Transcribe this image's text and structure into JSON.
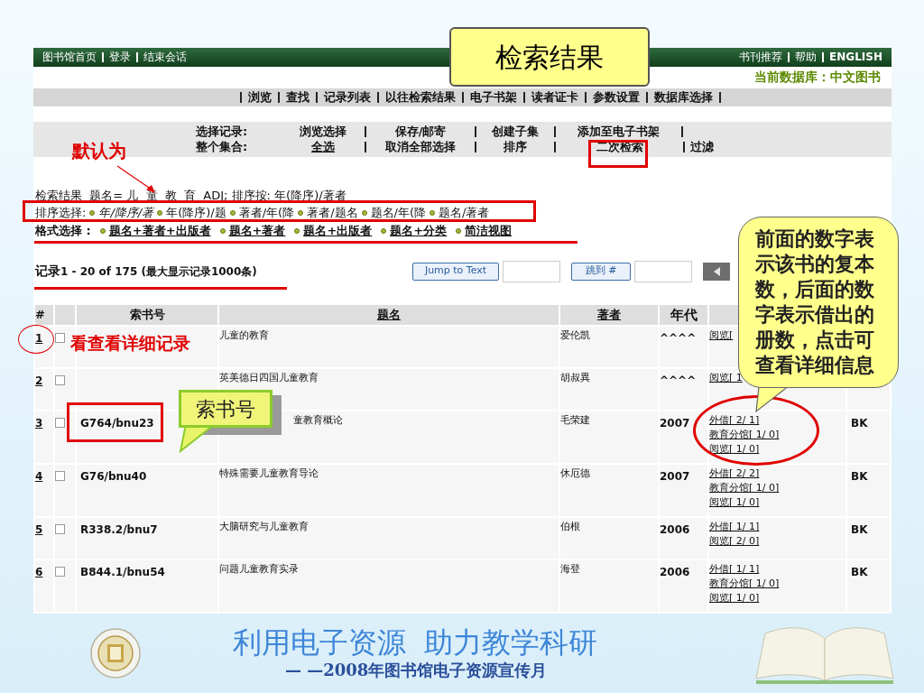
{
  "title_callout": "检索结果",
  "top_bar": {
    "left_links": [
      "图书馆首页",
      "登录",
      "结束会话"
    ],
    "right_links": [
      "书刊推荐",
      "帮助",
      "ENGLISH"
    ]
  },
  "current_database": "当前数据库：中文图书",
  "nav": [
    "浏览",
    "查找",
    "记录列表",
    "以往检索结果",
    "电子书架",
    "读者证卡",
    "参数设置",
    "数据库选择"
  ],
  "options": [
    {
      "label": "选择记录:",
      "items": [
        "浏览选择",
        "保存/邮寄",
        "创建子集",
        "添加至电子书架"
      ]
    },
    {
      "label": "整个集合:",
      "items": [
        "全选",
        "取消全部选择",
        "排序",
        "二次检索",
        "过滤"
      ]
    }
  ],
  "query": "检索结果  题名= 儿  童  教  育  ADJ; 排序按: 年(降序)/著者",
  "sort": {
    "label": "排序选择:",
    "options": [
      {
        "text": "年/降序/著",
        "selected": true
      },
      {
        "text": "年(降序)/题",
        "selected": false
      },
      {
        "text": "著者/年(降",
        "selected": false
      },
      {
        "text": "著者/题名",
        "selected": false
      },
      {
        "text": "题名/年(降",
        "selected": false
      },
      {
        "text": "题名/著者",
        "selected": false
      }
    ]
  },
  "format": {
    "label": "格式选择 :",
    "options": [
      "题名+著者+出版者",
      "题名+著者",
      "题名+出版者",
      "题名+分类",
      "简洁视图"
    ]
  },
  "records": {
    "label": "记录",
    "range": "1 - 20 of 175 (最大显示记录1000条)"
  },
  "jump_buttons": [
    "Jump to Text",
    "跳到 #"
  ],
  "table": {
    "columns": [
      "#",
      "索书号",
      "题名",
      "著者",
      "年代"
    ],
    "rows": [
      {
        "number": "1",
        "checked": false,
        "title": "儿童的教育",
        "author": "爱伦凯",
        "year": "^^^^",
        "holdings": [
          "阅览["
        ]
      },
      {
        "number": "2",
        "checked": false,
        "title": "英美德日四国儿童教育",
        "author": "胡叔異",
        "year": "^^^^",
        "holdings": [
          "阅览[ 1"
        ]
      },
      {
        "number": "3",
        "checked": false,
        "call_number": "G764/bnu23",
        "title": "童教育概论",
        "author": "毛荣建",
        "year": "2007",
        "holdings": [
          "外借[ 2/ 1]",
          "教育分馆[ 1/ 0]",
          "阅览[ 1/ 0]"
        ],
        "type": "BK"
      },
      {
        "number": "4",
        "checked": false,
        "call_number": "G76/bnu40",
        "title": "特殊需要儿童教育导论",
        "author": "休厄德",
        "year": "2007",
        "holdings": [
          "外借[ 2/ 2]",
          "教育分馆[ 1/ 0]",
          "阅览[ 1/ 0]"
        ],
        "type": "BK"
      },
      {
        "number": "5",
        "checked": false,
        "call_number": "R338.2/bnu7",
        "title": "大脑研究与儿童教育",
        "author": "伯根",
        "year": "2006",
        "holdings": [
          "外借[ 1/ 1]",
          "阅览[ 2/ 0]"
        ],
        "type": "BK"
      },
      {
        "number": "6",
        "checked": false,
        "call_number": "B844.1/bnu54",
        "title": "问题儿童教育实录",
        "author": "海登",
        "year": "2006",
        "holdings": [
          "外借[ 1/ 1]",
          "教育分馆[ 1/ 0]",
          "阅览[ 1/ 0]"
        ],
        "type": "BK"
      }
    ]
  },
  "annotations": {
    "default_note": "默认为",
    "detail_note": "看查看详细记录",
    "call_number_callout": "索书号",
    "holdings_callout": "前面的数字表示该书的复本数，后面的数字表示借出的册数，点击可查看详细信息"
  },
  "banner": {
    "title": "利用电子资源  助力教学科研",
    "subtitle": "— —2008年图书馆电子资源宣传月"
  }
}
